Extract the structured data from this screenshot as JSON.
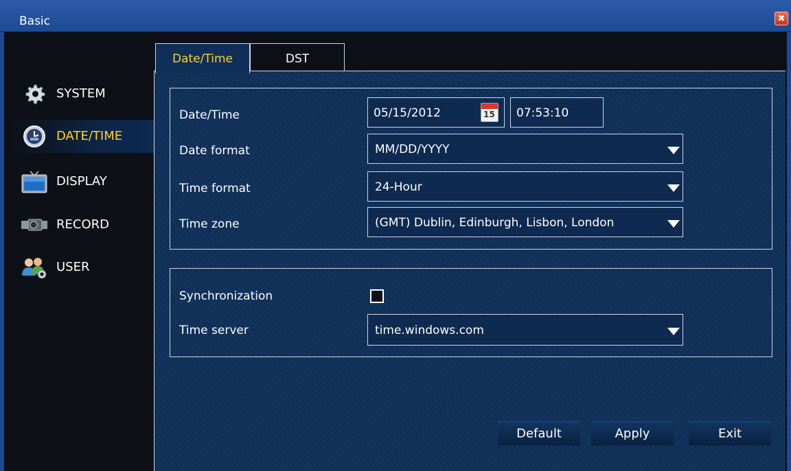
{
  "window": {
    "title": "Basic",
    "close_glyph": "✖"
  },
  "sidebar": {
    "items": [
      {
        "label": "SYSTEM",
        "icon": "gear-icon"
      },
      {
        "label": "DATE/TIME",
        "icon": "clock-icon",
        "active": true
      },
      {
        "label": "DISPLAY",
        "icon": "monitor-icon"
      },
      {
        "label": "RECORD",
        "icon": "camera-icon"
      },
      {
        "label": "USER",
        "icon": "users-icon"
      }
    ]
  },
  "tabs": [
    {
      "label": "Date/Time",
      "active": true
    },
    {
      "label": "DST",
      "active": false
    }
  ],
  "datetime": {
    "datetime_label": "Date/Time",
    "date_value": "05/15/2012",
    "calendar_day": "15",
    "time_value": "07:53:10",
    "date_format_label": "Date format",
    "date_format_value": "MM/DD/YYYY",
    "time_format_label": "Time format",
    "time_format_value": "24-Hour",
    "time_zone_label": "Time zone",
    "time_zone_value": "(GMT) Dublin, Edinburgh, Lisbon, London"
  },
  "sync": {
    "sync_label": "Synchronization",
    "sync_checked": false,
    "time_server_label": "Time server",
    "time_server_value": "time.windows.com"
  },
  "buttons": {
    "default": "Default",
    "apply": "Apply",
    "exit": "Exit"
  },
  "colors": {
    "accent": "#ffd224",
    "panel": "#0f2f58",
    "titlebar": "#2e5ba9"
  }
}
